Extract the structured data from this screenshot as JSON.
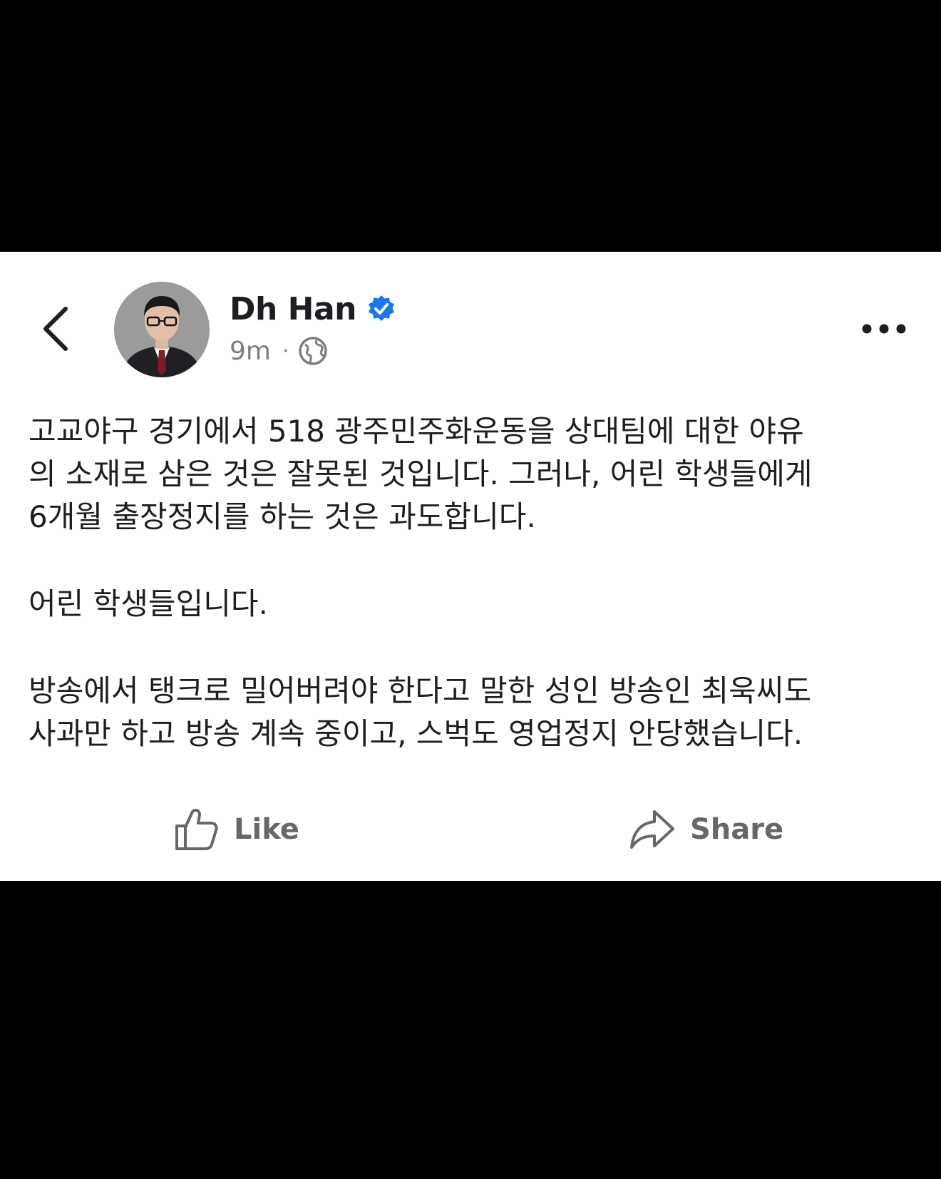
{
  "post": {
    "author_name": "Dh Han",
    "verified": true,
    "time": "9m",
    "separator": "·",
    "audience_icon": "globe-icon",
    "paragraphs": [
      "고교야구 경기에서 518 광주민주화운동을 상대팀에 대한 야유\n의 소재로 삼은 것은 잘못된 것입니다. 그러나, 어린 학생들에게\n6개월 출장정지를 하는 것은 과도합니다.",
      "어린 학생들입니다.",
      "방송에서 탱크로 밀어버려야 한다고 말한 성인 방송인 최욱씨도\n사과만 하고 방송 계속 중이고, 스벅도 영업정지 안당했습니다."
    ]
  },
  "actions": {
    "like_label": "Like",
    "share_label": "Share"
  },
  "icons": {
    "back": "chevron-left-icon",
    "more": "more-horizontal-icon",
    "verified": "verified-badge-icon",
    "like": "thumbs-up-icon",
    "share": "share-arrow-icon"
  },
  "colors": {
    "verified_blue": "#1877f2",
    "secondary_text": "#65676b",
    "primary_text": "#1c1e21"
  }
}
